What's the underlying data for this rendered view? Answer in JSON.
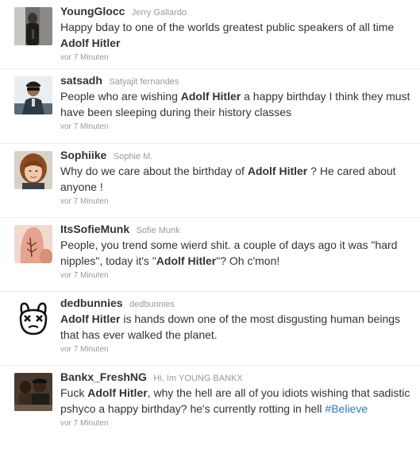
{
  "tweets": [
    {
      "screen_name": "YoungGlocc",
      "full_name": "Jerry Gallardo",
      "avatar_icon": "person-dark-photo",
      "parts": [
        {
          "t": "Happy bday to one of the worlds greatest public speakers of all time "
        },
        {
          "t": "Adolf Hitler",
          "b": true
        }
      ],
      "time": "vor 7 Minuten"
    },
    {
      "screen_name": "satsadh",
      "full_name": "Satyajit fernandes",
      "avatar_icon": "person-sunglasses-photo",
      "parts": [
        {
          "t": "People who are wishing "
        },
        {
          "t": "Adolf Hitler",
          "b": true
        },
        {
          "t": " a happy birthday I think they must have been sleeping during their history classes"
        }
      ],
      "time": "vor 7 Minuten"
    },
    {
      "screen_name": "Sophiike",
      "full_name": "Sophie M.",
      "avatar_icon": "person-redhair-photo",
      "parts": [
        {
          "t": "Why do we care about the birthday of "
        },
        {
          "t": "Adolf Hitler",
          "b": true
        },
        {
          "t": " ? He cared about anyone !"
        }
      ],
      "time": "vor 7 Minuten"
    },
    {
      "screen_name": "ItsSofieMunk",
      "full_name": "Sofie Munk",
      "avatar_icon": "finger-tattoo-photo",
      "parts": [
        {
          "t": "People, you trend some wierd shit. a couple of days ago it was \"hard nipples\", today it's \""
        },
        {
          "t": "Adolf Hitler",
          "b": true
        },
        {
          "t": "\"? Oh c'mon!"
        }
      ],
      "time": "vor 7 Minuten"
    },
    {
      "screen_name": "dedbunnies",
      "full_name": "dedbunnies",
      "avatar_icon": "dead-bunny-logo",
      "parts": [
        {
          "t": "Adolf Hitler",
          "b": true
        },
        {
          "t": " is hands down one of the most disgusting human beings that has ever walked the planet."
        }
      ],
      "time": "vor 7 Minuten"
    },
    {
      "screen_name": "Bankx_FreshNG",
      "full_name": "Hi, Im YOUNG BANKX",
      "avatar_icon": "person-group-photo",
      "parts": [
        {
          "t": "Fuck "
        },
        {
          "t": "Adolf Hitler",
          "b": true
        },
        {
          "t": ", why the hell are all of you idiots wishing that sadistic pshyco a happy birthday? he's currently rotting in hell "
        },
        {
          "t": "#Believe",
          "link": true
        }
      ],
      "time": "vor 7 Minuten"
    }
  ]
}
